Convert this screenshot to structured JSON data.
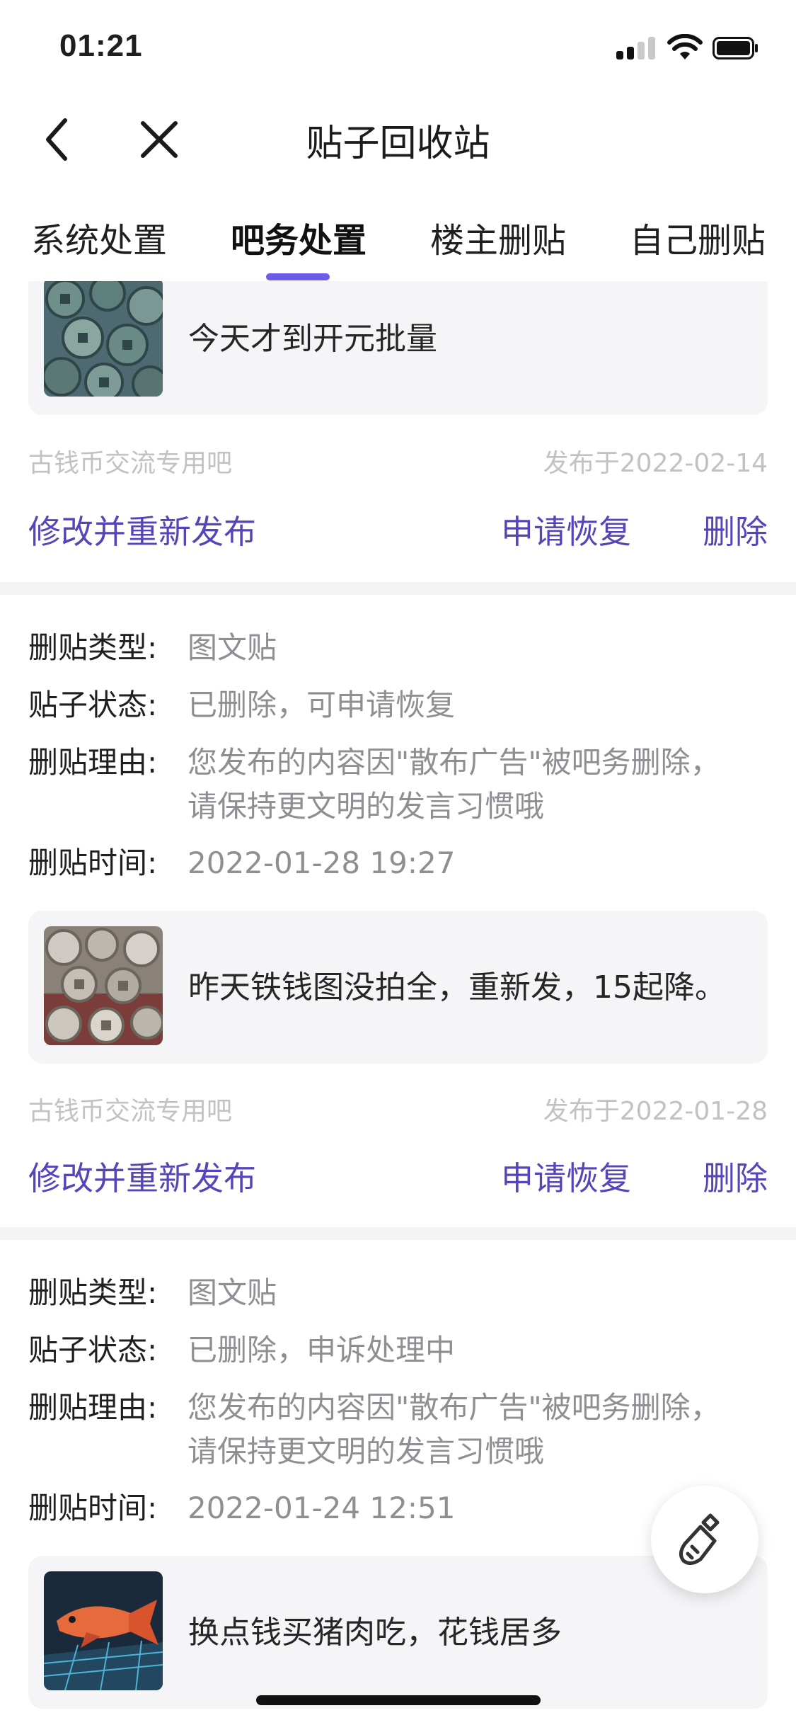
{
  "status_bar": {
    "time": "01:21",
    "signal_icon": "cellular-signal-icon",
    "wifi_icon": "wifi-icon",
    "battery_icon": "battery-icon"
  },
  "nav": {
    "title": "贴子回收站",
    "back_icon": "chevron-left-icon",
    "close_icon": "close-icon"
  },
  "tabs": [
    {
      "label": "系统处置",
      "active": false
    },
    {
      "label": "吧务处置",
      "active": true
    },
    {
      "label": "楼主删贴",
      "active": false
    },
    {
      "label": "自己删贴",
      "active": false
    }
  ],
  "accent_color": "#5446b8",
  "indicator_color": "#6a5ce8",
  "labels": {
    "type": "删贴类型:",
    "status": "贴子状态:",
    "reason": "删贴理由:",
    "time": "删贴时间:"
  },
  "actions": {
    "edit": "修改并重新发布",
    "restore": "申请恢复",
    "delete": "删除"
  },
  "posts": [
    {
      "title": "今天才到开元批量",
      "forum": "古钱币交流专用吧",
      "published": "发布于2022-02-14",
      "thumb_icon": "coins-thumbnail"
    },
    {
      "type": "图文贴",
      "status": "已删除，可申请恢复",
      "reason_line1": "您发布的内容因\"散布广告\"被吧务删除，",
      "reason_line2": "请保持更文明的发言习惯哦",
      "time": "2022-01-28 19:27",
      "title": "昨天铁钱图没拍全，重新发，15起降。",
      "forum": "古钱币交流专用吧",
      "published": "发布于2022-01-28",
      "thumb_icon": "coins-thumbnail"
    },
    {
      "type": "图文贴",
      "status": "已删除，申诉处理中",
      "reason_line1": "您发布的内容因\"散布广告\"被吧务删除，",
      "reason_line2": "请保持更文明的发言习惯哦",
      "time": "2022-01-24 12:51",
      "title": "换点钱买猪肉吃，花钱居多",
      "thumb_icon": "fish-thumbnail"
    }
  ],
  "fab": {
    "icon": "broom-icon"
  }
}
